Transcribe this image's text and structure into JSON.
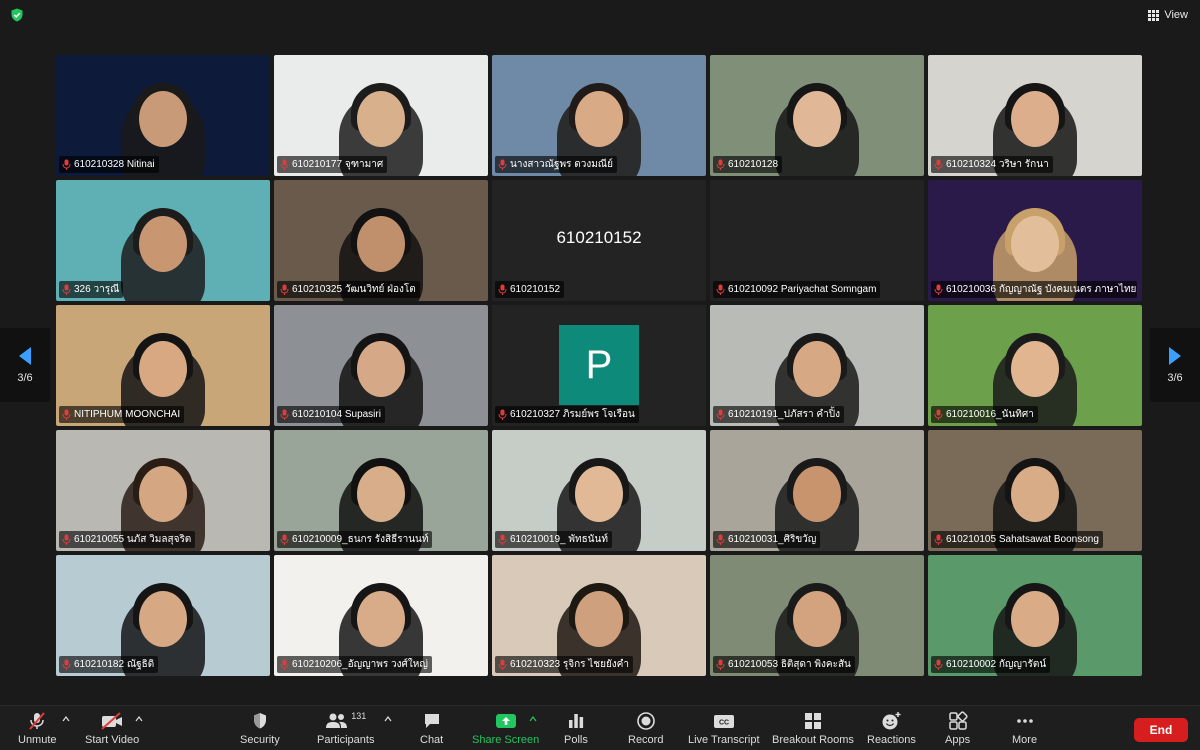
{
  "header": {
    "view_label": "View"
  },
  "pager": {
    "left_label": "3/6",
    "right_label": "3/6"
  },
  "tiles": [
    {
      "name": "610210328 Nitinai",
      "bg": "#0d1a3a",
      "skin": "#c89a78",
      "hair": "#1a1a1a"
    },
    {
      "name": "610210177 จุฑามาศ",
      "bg": "#e9ecea",
      "skin": "#d9b08c",
      "hair": "#1c1c1c"
    },
    {
      "name": "นางสาวณัฐพร ดวงมณีย์",
      "bg": "#6f8aa6",
      "skin": "#d8aa86",
      "hair": "#201b18"
    },
    {
      "name": "610210128",
      "bg": "#7f8f78",
      "skin": "#e0b898",
      "hair": "#161616"
    },
    {
      "name": "610210324 วริษา รักนา",
      "bg": "#d6d4cf",
      "skin": "#dcae8c",
      "hair": "#151515"
    },
    {
      "name": "326 วารุณี",
      "bg": "#5fb0b4",
      "skin": "#c99672",
      "hair": "#1c1c1c"
    },
    {
      "name": "610210325 วัฒนวิทย์ ฝ่องโต",
      "bg": "#6a5a4c",
      "skin": "#c08f6b",
      "hair": "#121212"
    },
    {
      "name": "610210152",
      "bg": "#232323",
      "namecard": "610210152"
    },
    {
      "name": "610210092 Pariyachat Somngam",
      "bg": "#232323"
    },
    {
      "name": "610210036 กัญญาณัฐ บังคมเนตร ภาษาไทย",
      "bg": "#2a1a4a",
      "skin": "#e3be9b",
      "hair": "#c7a06a"
    },
    {
      "name": "NITIPHUM MOONCHAI",
      "bg": "#c9a678",
      "skin": "#d8a882",
      "hair": "#141414"
    },
    {
      "name": "610210104 Supasiri",
      "bg": "#8d9094",
      "skin": "#d5a987",
      "hair": "#141414"
    },
    {
      "name": "610210327 ภิรมย์พร โจเรือน",
      "bg": "#232323",
      "initial": "P"
    },
    {
      "name": "610210191_ปภัสรา คำปิ้ง",
      "bg": "#b9bcb6",
      "skin": "#d7a884",
      "hair": "#1a1a1a"
    },
    {
      "name": "610210016_นันทิศา",
      "bg": "#6ca04a",
      "skin": "#e0b590",
      "hair": "#1b1b1b"
    },
    {
      "name": "610210055 นภัส วิมลสุจริต",
      "bg": "#b9b8b3",
      "skin": "#d4a681",
      "hair": "#2a1d16"
    },
    {
      "name": "610210009_ธนกร รังสิธีรานนท์",
      "bg": "#9aa59a",
      "skin": "#d8ad89",
      "hair": "#111"
    },
    {
      "name": "610210019_ พัทธนันท์",
      "bg": "#c6ccc6",
      "skin": "#e2b997",
      "hair": "#181818"
    },
    {
      "name": "610210031_ศิริขวัญ",
      "bg": "#a9a59a",
      "skin": "#c8946e",
      "hair": "#1a1a1a"
    },
    {
      "name": "610210105 Sahatsawat Boonsong",
      "bg": "#7a6a58",
      "skin": "#d9ac88",
      "hair": "#141414"
    },
    {
      "name": "610210182 ณัฐธิดิ",
      "bg": "#b7cbd3",
      "skin": "#d6a883",
      "hair": "#151515"
    },
    {
      "name": "610210206_อัญญาพร วงศ์ใหญ่",
      "bg": "#f2f1ee",
      "skin": "#d8ac88",
      "hair": "#161616"
    },
    {
      "name": "610210323 รุจิกร ไชยยังคำ",
      "bg": "#d8c9b8",
      "skin": "#cfa07d",
      "hair": "#1e1812"
    },
    {
      "name": "610210053 ธิติสุดา พิงคะสัน",
      "bg": "#7f8b75",
      "skin": "#d3a27e",
      "hair": "#1a1a1a"
    },
    {
      "name": "610210002 กัญญารัตน์",
      "bg": "#5a9a6a",
      "skin": "#d9ab86",
      "hair": "#161616"
    }
  ],
  "toolbar": {
    "unmute": "Unmute",
    "start_video": "Start Video",
    "security": "Security",
    "participants": "Participants",
    "participants_count": "131",
    "chat": "Chat",
    "share_screen": "Share Screen",
    "polls": "Polls",
    "record": "Record",
    "live_transcript": "Live Transcript",
    "breakout_rooms": "Breakout Rooms",
    "reactions": "Reactions",
    "apps": "Apps",
    "more": "More",
    "end": "End",
    "share_color": "#22c55e",
    "end_color": "#d71e1e"
  }
}
